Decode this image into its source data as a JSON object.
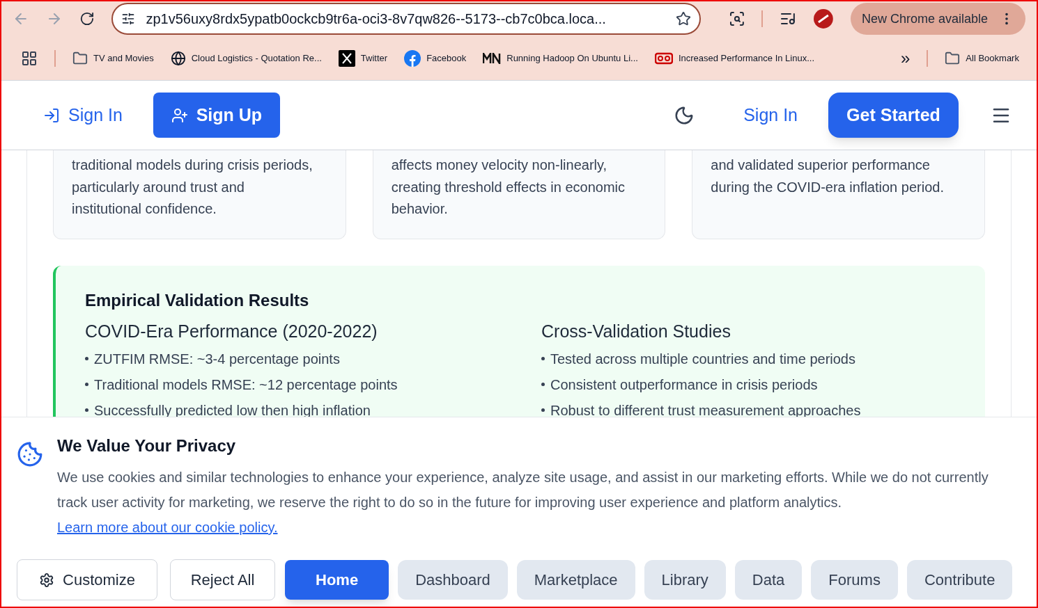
{
  "browser": {
    "url": "zp1v56uxy8rdx5ypatb0ockcb9tr6a-oci3-8v7qw826--5173--cb7c0bca.loca...",
    "update_button": "New Chrome available",
    "bookmarks": [
      {
        "kind": "folder",
        "label": "TV and Movies"
      },
      {
        "kind": "globe",
        "label": "Cloud Logistics - Quotation Re..."
      },
      {
        "kind": "x",
        "label": "Twitter"
      },
      {
        "kind": "facebook",
        "label": "Facebook"
      },
      {
        "kind": "mn",
        "label": "Running Hadoop On Ubuntu Li..."
      },
      {
        "kind": "reel",
        "label": "Increased Performance In Linux..."
      }
    ],
    "more_bookmarks": "»",
    "all_bookmarks": "All Bookmark"
  },
  "header": {
    "sign_in_left": "Sign In",
    "sign_up": "Sign Up",
    "sign_in_right": "Sign In",
    "get_started": "Get Started"
  },
  "cards": [
    {
      "text": "traditional models during crisis periods, particularly around trust and institutional confidence."
    },
    {
      "text": "affects money velocity non-linearly, creating threshold effects in economic behavior."
    },
    {
      "text": "and validated superior performance during the COVID-era inflation period."
    }
  ],
  "validation": {
    "title": "Empirical Validation Results",
    "columns": [
      {
        "heading": "COVID-Era Performance (2020-2022)",
        "bullets": [
          "ZUTFIM RMSE: ~3-4 percentage points",
          "Traditional models RMSE: ~12 percentage points",
          "Successfully predicted low then high inflation"
        ]
      },
      {
        "heading": "Cross-Validation Studies",
        "bullets": [
          "Tested across multiple countries and time periods",
          "Consistent outperformance in crisis periods",
          "Robust to different trust measurement approaches"
        ]
      }
    ]
  },
  "cookie": {
    "title": "We Value Your Privacy",
    "text": "We use cookies and similar technologies to enhance your experience, analyze site usage, and assist in our marketing efforts. While we do not currently track user activity for marketing, we reserve the right to do so in the future for improving user experience and platform analytics.",
    "link": "Learn more about our cookie policy.",
    "customize": "Customize",
    "reject": "Reject All"
  },
  "nav": [
    {
      "label": "Home",
      "selected": true
    },
    {
      "label": "Dashboard",
      "selected": false
    },
    {
      "label": "Marketplace",
      "selected": false
    },
    {
      "label": "Library",
      "selected": false
    },
    {
      "label": "Data",
      "selected": false
    },
    {
      "label": "Forums",
      "selected": false
    },
    {
      "label": "Contribute",
      "selected": false
    }
  ]
}
